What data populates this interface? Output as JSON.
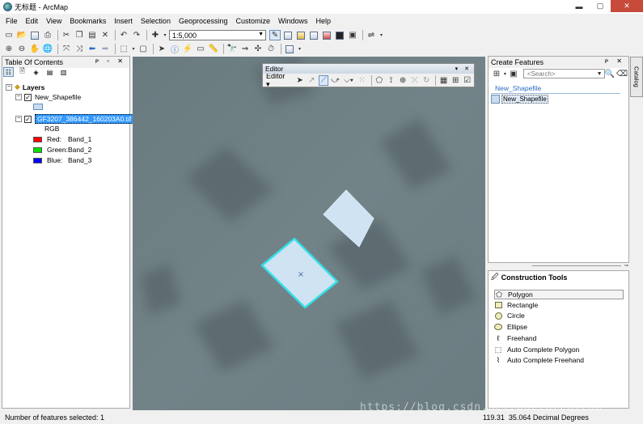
{
  "window": {
    "title": "无标题 - ArcMap",
    "minimize_glyph": "▬",
    "maximize_glyph": "▢",
    "close_glyph": "✕"
  },
  "menu": [
    "File",
    "Edit",
    "View",
    "Bookmarks",
    "Insert",
    "Selection",
    "Geoprocessing",
    "Customize",
    "Windows",
    "Help"
  ],
  "standard_toolbar": {
    "scale": "1:5,000"
  },
  "toc": {
    "title": "Table Of Contents",
    "controls": "ᴘ ▫ ✕",
    "layers_label": "Layers",
    "items": [
      {
        "label": "New_Shapefile",
        "checked": true
      },
      {
        "label": "GF3207_386442_160203A0.tif",
        "checked": true,
        "selected": true
      }
    ],
    "rgb_label": "RGB",
    "bands": [
      {
        "channel": "Red:",
        "band": "Band_1",
        "color": "#ff0000"
      },
      {
        "channel": "Green:",
        "band": "Band_2",
        "color": "#00e000"
      },
      {
        "channel": "Blue:",
        "band": "Band_3",
        "color": "#0000ff"
      }
    ],
    "shapefile_fill": "#c8dcf0"
  },
  "editor": {
    "title": "Editor",
    "menu_label": "Editor ▾",
    "controls": "▾ ✕"
  },
  "create_features": {
    "title": "Create Features",
    "search_placeholder": "<Search>",
    "template_group": "New_Shapefile",
    "template_item": "New_Shapefile"
  },
  "construction_tools": {
    "title": "Construction Tools",
    "items": [
      {
        "label": "Polygon",
        "icon": "polygon-icon",
        "selected": true
      },
      {
        "label": "Rectangle",
        "icon": "rectangle-icon"
      },
      {
        "label": "Circle",
        "icon": "circle-icon"
      },
      {
        "label": "Ellipse",
        "icon": "ellipse-icon"
      },
      {
        "label": "Freehand",
        "icon": "freehand-icon"
      },
      {
        "label": "Auto Complete Polygon",
        "icon": "auto-complete-polygon-icon"
      },
      {
        "label": "Auto Complete Freehand",
        "icon": "auto-complete-freehand-icon"
      }
    ]
  },
  "catalog_tab": "Catalog",
  "status": {
    "selected": "Number of features selected: 1",
    "coords": "119.31  35.064 Decimal Degrees"
  },
  "watermark": "https://blog.csdn.net/DoctorCuiLab",
  "colors": {
    "selection": "#33e0e8",
    "polygon_fill": "#cce4f6",
    "map_bg": "#6f7f84"
  }
}
